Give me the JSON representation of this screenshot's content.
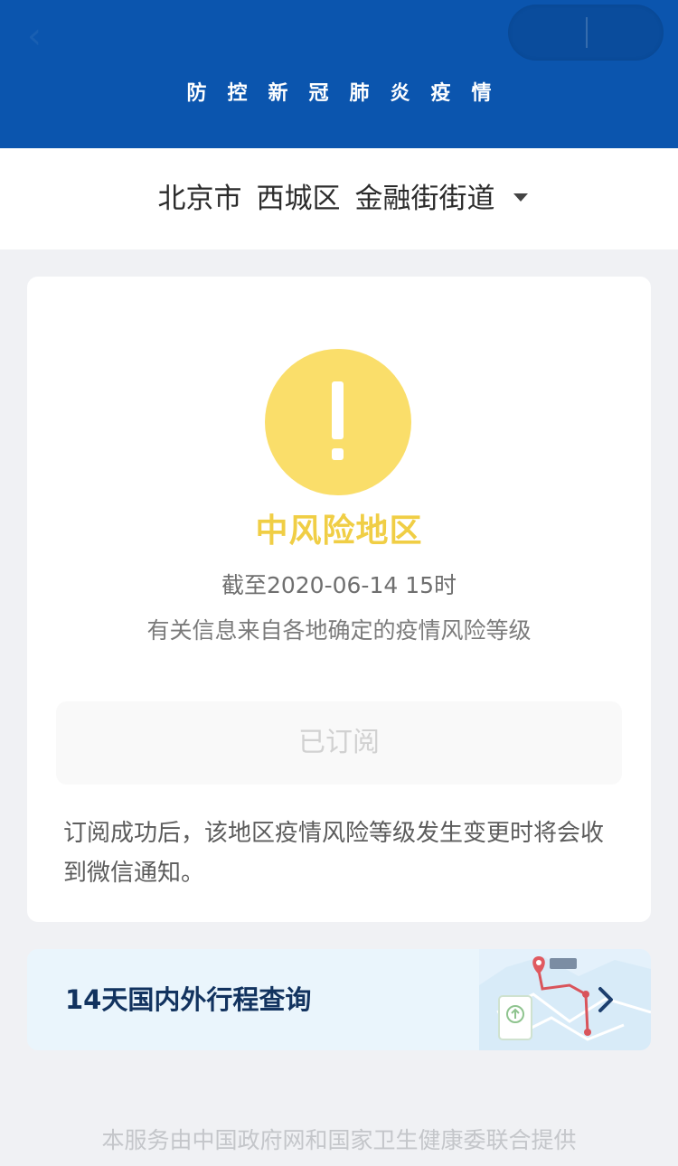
{
  "header": {
    "title": "防控新冠肺炎疫情"
  },
  "location": {
    "city": "北京市",
    "district": "西城区",
    "street": "金融街街道"
  },
  "risk": {
    "level": "中风险地区",
    "as_of": "截至2020-06-14 15时",
    "source_note": "有关信息来自各地确定的疫情风险等级",
    "level_color": "#f0ce45",
    "icon_color": "#fade6a"
  },
  "subscribe": {
    "button_label": "已订阅",
    "note": "订阅成功后，该地区疫情风险等级发生变更时将会收到微信通知。"
  },
  "itinerary": {
    "label": "14天国内外行程查询"
  },
  "footer": {
    "text": "本服务由中国政府网和国家卫生健康委联合提供"
  },
  "colors": {
    "brand_blue": "#0b55ae",
    "page_bg": "#f0f1f4"
  },
  "icons": {
    "warning": "exclamation-icon",
    "chevron": "chevron-right-icon",
    "dropdown": "caret-down-icon"
  }
}
